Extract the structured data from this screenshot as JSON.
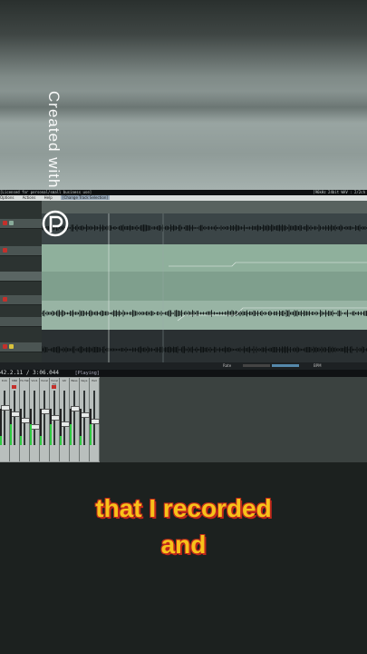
{
  "overlay": {
    "watermark_text": "Created with",
    "logo_icon": "p-circle-logo-icon"
  },
  "daw": {
    "title_left": "[Licensed for personal/small business use]",
    "title_right": "[96kHz 24bit WAV : 2/2ch",
    "menu": [
      "Options",
      "Actions",
      "Help",
      "[Change Track Selection]"
    ],
    "timecode": "42.2.11 / 3:06.044",
    "play_state": "[Playing]",
    "transport_labels": [
      "Rate",
      "BPM"
    ],
    "mixer_labels": [
      "Kick",
      "SNR",
      "Hi-Hat",
      "Vox1",
      "Vocal",
      "Vocal FX",
      "Gtr",
      "Bass",
      "Keys",
      "Pad"
    ],
    "colors": {
      "selected_lane": "#9fb8a8",
      "waveform": "#0b0f10",
      "rec": "#c4302b",
      "meter": "#2ecc40"
    }
  },
  "caption": {
    "line1": "that I recorded",
    "line2": "and"
  }
}
